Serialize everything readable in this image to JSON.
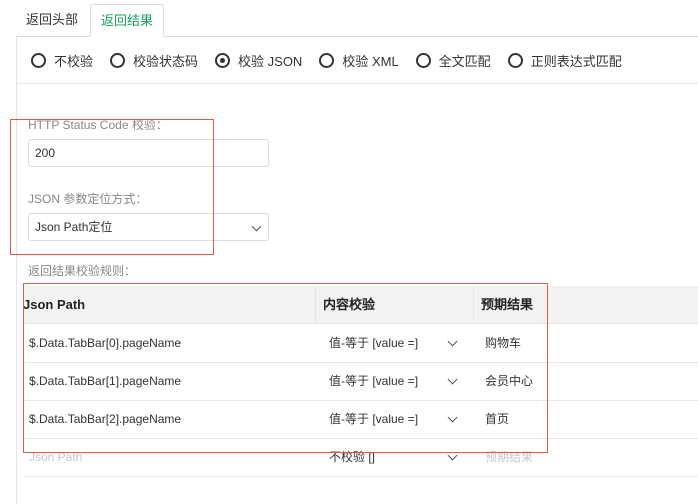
{
  "tabs": [
    {
      "label": "返回头部",
      "active": false
    },
    {
      "label": "返回结果",
      "active": true
    }
  ],
  "radio_options": [
    {
      "label": "不校验",
      "selected": false
    },
    {
      "label": "校验状态码",
      "selected": false
    },
    {
      "label": "校验 JSON",
      "selected": true
    },
    {
      "label": "校验 XML",
      "selected": false
    },
    {
      "label": "全文匹配",
      "selected": false
    },
    {
      "label": "正则表达式匹配",
      "selected": false
    }
  ],
  "status_code": {
    "label": "HTTP Status Code 校验：",
    "value": "200"
  },
  "locate_method": {
    "label": "JSON 参数定位方式：",
    "value": "Json Path定位"
  },
  "rules_label": "返回结果校验规则：",
  "table": {
    "headers": [
      "Json Path",
      "内容校验",
      "预期结果"
    ],
    "rows": [
      {
        "path": "$.Data.TabBar[0].pageName",
        "check": "值-等于 [value =]",
        "expected": "购物车"
      },
      {
        "path": "$.Data.TabBar[1].pageName",
        "check": "值-等于 [value =]",
        "expected": "会员中心"
      },
      {
        "path": "$.Data.TabBar[2].pageName",
        "check": "值-等于 [value =]",
        "expected": "首页"
      }
    ],
    "new_row": {
      "path_placeholder": "Json Path",
      "check": "不校验 []",
      "expected_placeholder": "预期结果"
    }
  },
  "colors": {
    "accent": "#1aa35c",
    "highlight_box": "#e05a4b",
    "header_bg": "#f2f2f2"
  }
}
